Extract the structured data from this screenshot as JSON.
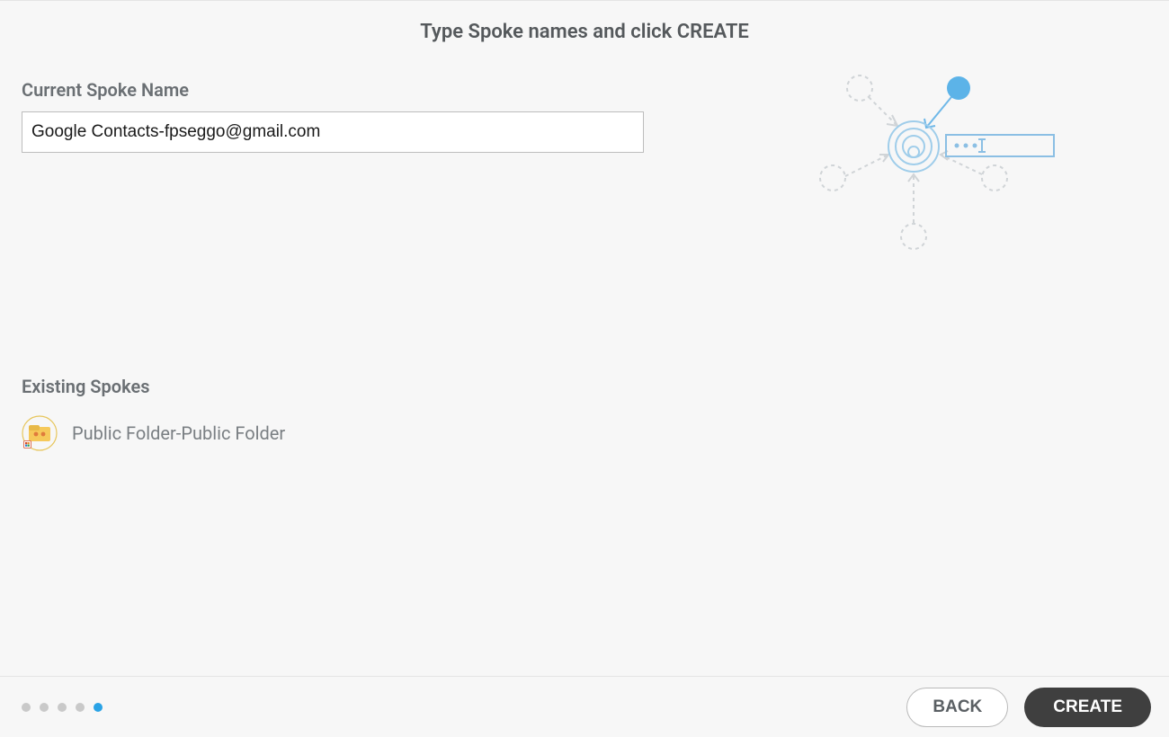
{
  "header": {
    "title": "Type Spoke names and click CREATE"
  },
  "form": {
    "current_spoke_label": "Current Spoke Name",
    "current_spoke_value": "Google Contacts-fpseggo@gmail.com"
  },
  "existing": {
    "title": "Existing Spokes",
    "items": [
      {
        "label": "Public Folder-Public Folder"
      }
    ]
  },
  "footer": {
    "back_label": "BACK",
    "create_label": "CREATE",
    "total_steps": 5,
    "active_step_index": 4
  }
}
